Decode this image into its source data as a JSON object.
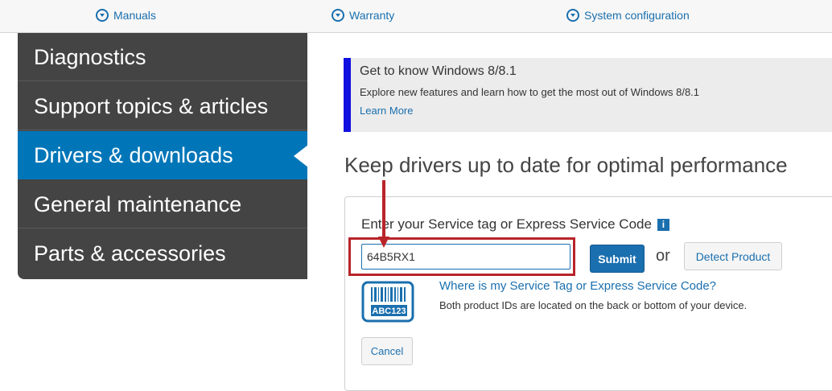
{
  "topnav": {
    "items": [
      {
        "label": "Manuals",
        "icon": "chevron-down-circle-icon"
      },
      {
        "label": "Warranty",
        "icon": "chevron-down-circle-icon"
      },
      {
        "label": "System configuration",
        "icon": "chevron-down-circle-icon"
      }
    ]
  },
  "sidebar": {
    "items": [
      {
        "label": "Diagnostics",
        "active": false
      },
      {
        "label": "Support topics & articles",
        "active": false
      },
      {
        "label": "Drivers & downloads",
        "active": true
      },
      {
        "label": "General maintenance",
        "active": false
      },
      {
        "label": "Parts & accessories",
        "active": false
      }
    ]
  },
  "banner": {
    "title": "Get to know Windows 8/8.1",
    "description": "Explore new features and learn how to get the most out of Windows 8/8.1",
    "link": "Learn More"
  },
  "main": {
    "heading": "Keep drivers up to date for optimal performance"
  },
  "service_form": {
    "label": "Enter your Service tag or Express Service Code",
    "info_icon": "i",
    "input_value": "64B5RX1",
    "submit_label": "Submit",
    "or_text": "or",
    "detect_label": "Detect Product",
    "tag_graphic_text": "ABC123",
    "where_link": "Where is my Service Tag or Express Service Code?",
    "where_desc": "Both product IDs are located on the back or bottom of your device.",
    "cancel_label": "Cancel"
  },
  "colors": {
    "accent": "#1a6fae",
    "sidebar_bg": "#444444",
    "sidebar_active": "#0076b8",
    "banner_bar": "#1010e0",
    "highlight": "#b8242a"
  }
}
